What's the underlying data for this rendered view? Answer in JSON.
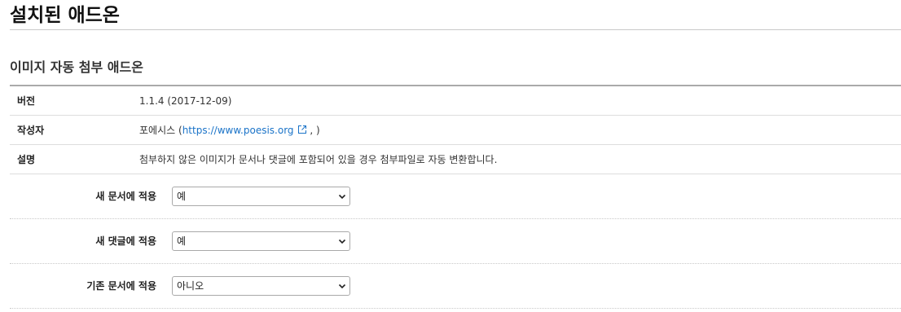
{
  "page": {
    "title": "설치된 애드온"
  },
  "addon": {
    "name": "이미지 자동 첨부 애드온",
    "info": {
      "version_label": "버전",
      "version_value": "1.1.4 (2017-12-09)",
      "author_label": "작성자",
      "author_name": "포에시스",
      "author_open": "(",
      "author_link": "https://www.poesis.org",
      "author_close": ", )",
      "description_label": "설명",
      "description_value": "첨부하지 않은 이미지가 문서나 댓글에 포함되어 있을 경우 첨부파일로 자동 변환합니다."
    },
    "settings": [
      {
        "label": "새 문서에 적용",
        "selected": "예"
      },
      {
        "label": "새 댓글에 적용",
        "selected": "예"
      },
      {
        "label": "기존 문서에 적용",
        "selected": "아니오"
      }
    ]
  },
  "colors": {
    "link": "#1a73c8",
    "border": "#dddddd",
    "title_rule": "#c8c8c8"
  },
  "icons": {
    "external_link": "external-link-icon",
    "select_arrow": "chevron-down-icon"
  }
}
